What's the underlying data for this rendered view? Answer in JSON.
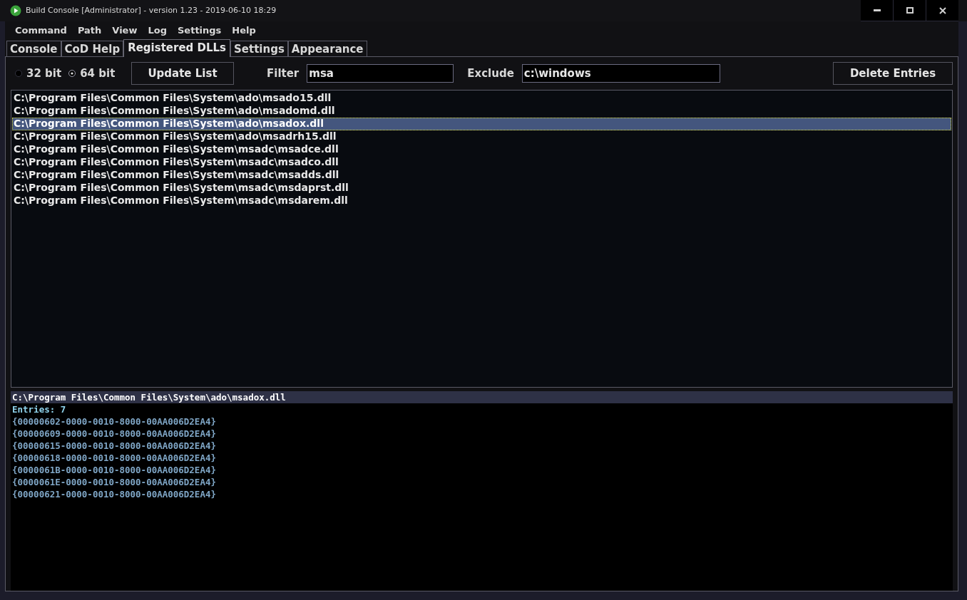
{
  "window": {
    "title": "Build Console [Administrator] - version 1.23 - 2019-06-10 18:29"
  },
  "menu": [
    "Command",
    "Path",
    "View",
    "Log",
    "Settings",
    "Help"
  ],
  "tabs": [
    {
      "label": "Console",
      "selected": false
    },
    {
      "label": "CoD Help",
      "selected": false
    },
    {
      "label": "Registered DLLs",
      "selected": true
    },
    {
      "label": "Settings",
      "selected": false
    },
    {
      "label": "Appearance",
      "selected": false
    }
  ],
  "bitness": [
    {
      "label": "32 bit",
      "selected": false
    },
    {
      "label": "64 bit",
      "selected": true
    }
  ],
  "update_button": "Update List",
  "filter": {
    "label": "Filter",
    "value": "msa"
  },
  "exclude": {
    "label": "Exclude",
    "value": "c:\\windows"
  },
  "delete_button": "Delete Entries",
  "dll_list": [
    {
      "path": "C:\\Program Files\\Common Files\\System\\ado\\msado15.dll",
      "selected": false
    },
    {
      "path": "C:\\Program Files\\Common Files\\System\\ado\\msadomd.dll",
      "selected": false
    },
    {
      "path": "C:\\Program Files\\Common Files\\System\\ado\\msadox.dll",
      "selected": true
    },
    {
      "path": "C:\\Program Files\\Common Files\\System\\ado\\msadrh15.dll",
      "selected": false
    },
    {
      "path": "C:\\Program Files\\Common Files\\System\\msadc\\msadce.dll",
      "selected": false
    },
    {
      "path": "C:\\Program Files\\Common Files\\System\\msadc\\msadco.dll",
      "selected": false
    },
    {
      "path": "C:\\Program Files\\Common Files\\System\\msadc\\msadds.dll",
      "selected": false
    },
    {
      "path": "C:\\Program Files\\Common Files\\System\\msadc\\msdaprst.dll",
      "selected": false
    },
    {
      "path": "C:\\Program Files\\Common Files\\System\\msadc\\msdarem.dll",
      "selected": false
    }
  ],
  "details": {
    "header": "C:\\Program Files\\Common Files\\System\\ado\\msadox.dll",
    "entries": "Entries: 7",
    "guids": [
      "{00000602-0000-0010-8000-00AA006D2EA4}",
      "{00000609-0000-0010-8000-00AA006D2EA4}",
      "{00000615-0000-0010-8000-00AA006D2EA4}",
      "{00000618-0000-0010-8000-00AA006D2EA4}",
      "{0000061B-0000-0010-8000-00AA006D2EA4}",
      "{0000061E-0000-0010-8000-00AA006D2EA4}",
      "{00000621-0000-0010-8000-00AA006D2EA4}"
    ]
  }
}
